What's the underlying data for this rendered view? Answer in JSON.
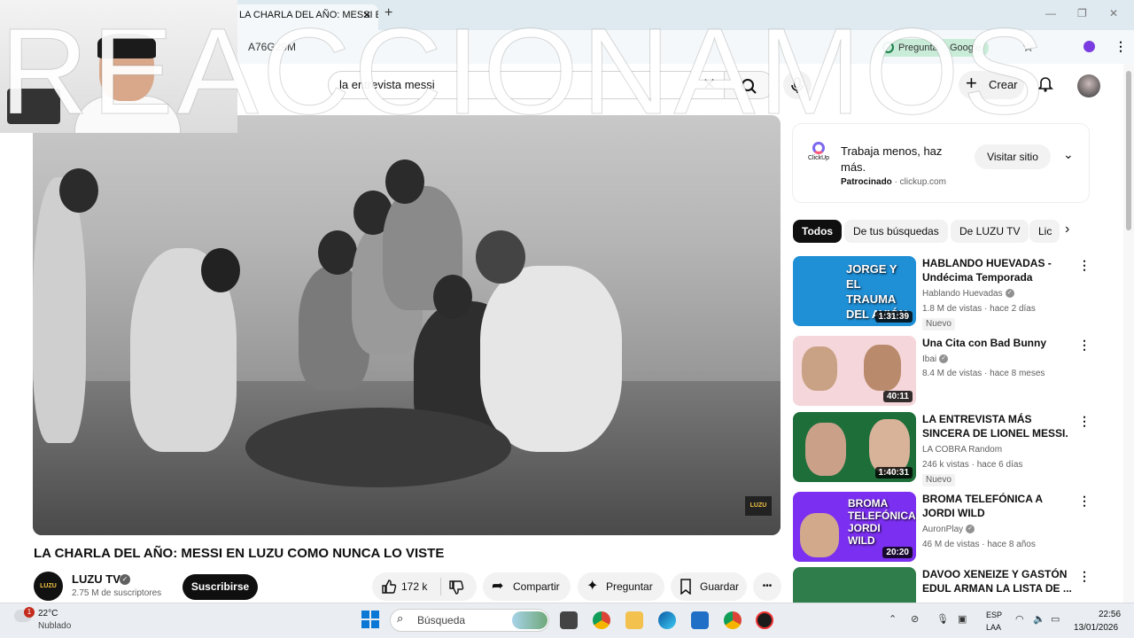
{
  "browser": {
    "tab_title": "LA CHARLA DEL AÑO: MESSI EN",
    "tab_close": "✕",
    "new_tab": "+",
    "window_controls": [
      "—",
      "❐",
      "✕"
    ],
    "url_fragment": "A76G29M",
    "gemini_chip_label": "Pregunta",
    "gemini_chip_brand": "Google",
    "bookmark_icon": "star-icon",
    "profile_icon": "profile-icon",
    "menu_icon": "kebab-icon"
  },
  "overlay": {
    "text": "REACCIONAMOS"
  },
  "youtube_header": {
    "search_value": "la entrevista messi",
    "search_clear": "✕",
    "mic_icon": "microphone-icon",
    "create_label": "Crear",
    "create_icon": "+",
    "bell_icon": "🔔"
  },
  "player": {
    "logo_text": "LUZU"
  },
  "video": {
    "title": "LA CHARLA DEL AÑO: MESSI EN LUZU COMO NUNCA LO VISTE",
    "channel": "LUZU TV",
    "channel_avatar_text": "LUZU",
    "verified_mark": "✓",
    "subscribers": "2.75 M de suscriptores",
    "subscribe_label": "Suscribirse",
    "likes": "172 k",
    "share_label": "Compartir",
    "ask_label": "Preguntar",
    "save_label": "Guardar",
    "more_label": "•••",
    "like_icon": "👍",
    "dislike_icon": "👎",
    "share_icon": "➦",
    "ask_icon": "✦",
    "save_icon": "🔖"
  },
  "ad": {
    "logo_text": "ClickUp",
    "title": "Trabaja menos, haz más.",
    "sponsored": "Patrocinado",
    "domain": "· clickup.com",
    "cta": "Visitar sitio",
    "chevron": "⌄"
  },
  "chips": [
    "Todos",
    "De tus búsquedas",
    "De LUZU TV",
    "Lic"
  ],
  "chip_next": "›",
  "recommendations": [
    {
      "title": "HABLANDO HUEVADAS - Undécima Temporada [JORGE ...",
      "channel": "Hablando Huevadas",
      "verified": true,
      "views": "1.8 M de vistas",
      "age": "hace 2 días",
      "badge": "Nuevo",
      "duration": "1:31:39",
      "thumb_text": "JORGE Y EL TRAUMA DEL AVIÓN",
      "thumb_color": "#1f8fd6"
    },
    {
      "title": "Una Cita con Bad Bunny",
      "channel": "Ibai",
      "verified": true,
      "views": "8.4 M de vistas",
      "age": "hace 8 meses",
      "badge": "",
      "duration": "40:11",
      "thumb_text": "",
      "thumb_color": "#f5d6da"
    },
    {
      "title": "LA ENTREVISTA MÁS SINCERA DE LIONEL MESSI. ¿IBA A ...",
      "channel": "LA COBRA Random",
      "verified": false,
      "views": "246 k vistas",
      "age": "hace 6 días",
      "badge": "Nuevo",
      "duration": "1:40:31",
      "thumb_text": "",
      "thumb_color": "#1e6e3a"
    },
    {
      "title": "BROMA TELEFÓNICA A JORDI WILD",
      "channel": "AuronPlay",
      "verified": true,
      "views": "46 M de vistas",
      "age": "hace 8 años",
      "badge": "",
      "duration": "20:20",
      "thumb_text": "BROMA TELEFÓNICA JORDI WILD",
      "thumb_color": "#7b2ff0"
    },
    {
      "title": "DAVOO XENEIZE Y GASTÓN EDUL ARMAN LA LISTA DE ...",
      "channel": "",
      "verified": false,
      "views": "",
      "age": "",
      "badge": "",
      "duration": "",
      "thumb_text": "",
      "thumb_color": "#2f7d4a"
    }
  ],
  "taskbar": {
    "weather_badge": "1",
    "temperature": "22°C",
    "weather": "Nublado",
    "search_label": "Búsqueda",
    "lang1": "ESP",
    "lang2": "LAA",
    "time": "22:56",
    "date": "13/01/2026"
  }
}
